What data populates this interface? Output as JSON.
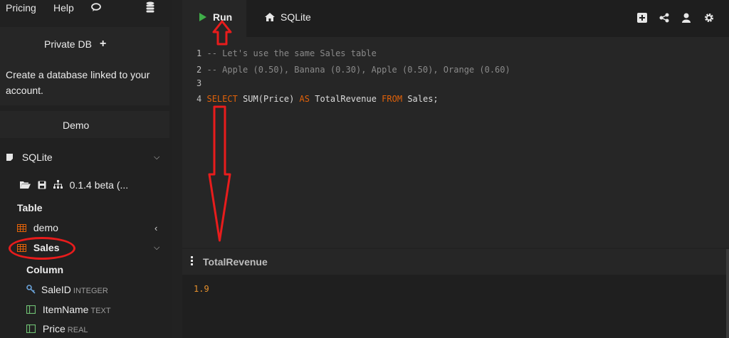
{
  "topnav": {
    "pricing": "Pricing",
    "help": "Help"
  },
  "private_db": {
    "title": "Private DB",
    "plus": "+",
    "description": "Create a database linked to your account."
  },
  "demo": {
    "label": "Demo"
  },
  "tree": {
    "db_name": "SQLite",
    "version": "0.1.4 beta (...",
    "table_header": "Table",
    "tables": [
      "demo",
      "Sales"
    ],
    "column_header": "Column",
    "columns": [
      {
        "name": "SaleID",
        "type": "INTEGER"
      },
      {
        "name": "ItemName",
        "type": "TEXT"
      },
      {
        "name": "Price",
        "type": "REAL"
      }
    ]
  },
  "tabs": {
    "run": "Run",
    "sqlite": "SQLite"
  },
  "editor": {
    "lines": [
      {
        "num": "1",
        "text": "-- Let's use the same Sales table"
      },
      {
        "num": "2",
        "text": "-- Apple (0.50), Banana (0.30), Apple (0.50), Orange (0.60)"
      },
      {
        "num": "3",
        "text": ""
      },
      {
        "num": "4",
        "kw1": "SELECT",
        "fn": "SUM(Price)",
        "kw2": "AS",
        "alias": "TotalRevenue",
        "kw3": "FROM",
        "tbl": "Sales;"
      }
    ]
  },
  "results": {
    "column": "TotalRevenue",
    "value": "1.9"
  },
  "icons": {
    "chat": "chat-icon",
    "database": "database-icon",
    "plus": "plus-icon",
    "play": "play-icon",
    "home": "home-icon",
    "add": "add-square-icon",
    "share": "share-icon",
    "user": "user-icon",
    "settings": "gear-icon"
  },
  "colors": {
    "accent_keyword": "#e36209",
    "result_value": "#e8912d",
    "run_play": "#3fae49",
    "annotation": "#e81c1c"
  }
}
